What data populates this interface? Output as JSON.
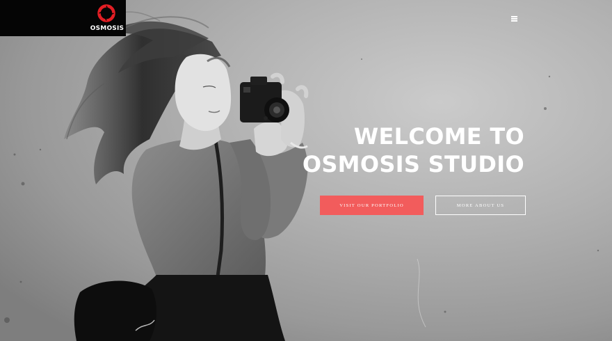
{
  "brand": {
    "name": "OSMOSIS",
    "logo_icon": "aperture-ring-icon",
    "accent": "#e31e24"
  },
  "header": {
    "menu_icon": "hamburger-menu-icon"
  },
  "hero": {
    "title_line1": "WELCOME TO",
    "title_line2": "OSMOSIS STUDIO",
    "primary_button": "VISIT OUR PORTFOLIO",
    "secondary_button": "MORE ABOUT US",
    "primary_color": "#f25c5c",
    "image": "black-and-white photo of a woman holding a camera against a concrete wall"
  }
}
